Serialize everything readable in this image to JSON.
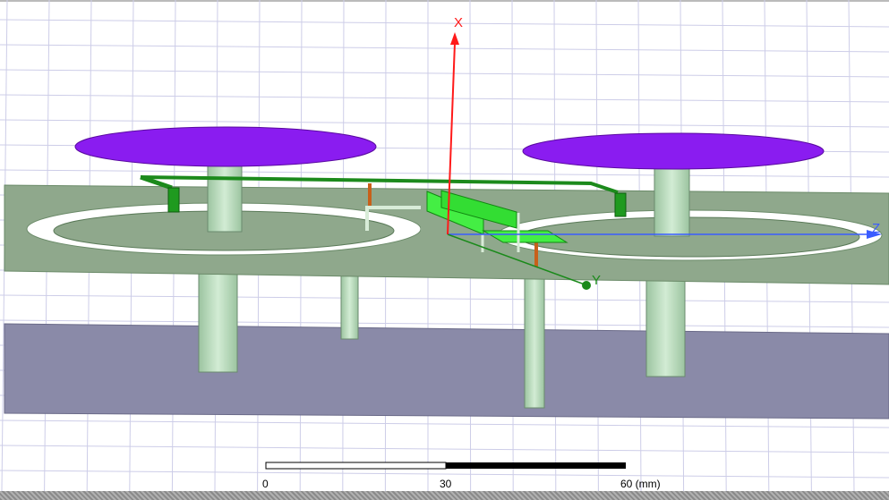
{
  "axes": {
    "x_label": "X",
    "y_label": "Y",
    "z_label": "Z",
    "x_color": "#ff1a1a",
    "y_color": "#1a8a1a",
    "z_color": "#3a5cff"
  },
  "scale_bar": {
    "ticks": [
      "0",
      "30",
      "60 (mm)"
    ]
  },
  "colors": {
    "patch": "#8a1cf0",
    "substrate": "#8fa88c",
    "ground": "#8a8aa8",
    "feed": "#33dd33",
    "post": "#b8dcbc"
  }
}
